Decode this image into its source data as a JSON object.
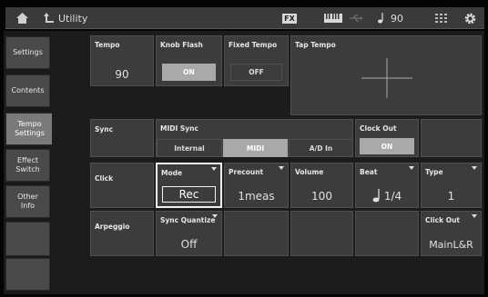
{
  "topbar": {
    "title": "Utility",
    "fx_label": "FX",
    "tempo": "90",
    "icons": [
      "home-icon",
      "back-arrow-icon",
      "keyboard-icon",
      "usb-icon",
      "note-icon",
      "grid-icon",
      "gear-icon"
    ]
  },
  "sidebar": {
    "items": [
      {
        "label": "Settings"
      },
      {
        "label": "Contents"
      },
      {
        "label": "Tempo\nSettings"
      },
      {
        "label": "Effect\nSwitch"
      },
      {
        "label": "Other\nInfo"
      }
    ]
  },
  "tempo": {
    "label": "Tempo",
    "value": "90"
  },
  "knob_flash": {
    "label": "Knob Flash",
    "value": "ON"
  },
  "fixed_tempo": {
    "label": "Fixed Tempo",
    "value": "OFF"
  },
  "tap_tempo": {
    "label": "Tap Tempo"
  },
  "sync": {
    "label": "Sync",
    "midi_sync_label": "MIDI Sync",
    "options": [
      "Internal",
      "MIDI",
      "A/D In"
    ],
    "selected": "MIDI",
    "clock_out_label": "Clock Out",
    "clock_out_value": "ON"
  },
  "click": {
    "label": "Click",
    "mode_label": "Mode",
    "mode_value": "Rec",
    "precount_label": "Precount",
    "precount_value": "1meas",
    "volume_label": "Volume",
    "volume_value": "100",
    "beat_label": "Beat",
    "beat_value": "1/4",
    "type_label": "Type",
    "type_value": "1"
  },
  "arpeggio": {
    "label": "Arpeggio",
    "sync_quantize_label": "Sync Quantize",
    "sync_quantize_value": "Off",
    "click_out_label": "Click Out",
    "click_out_value": "MainL&R"
  },
  "colors": {
    "active_button": "#a9a9a9",
    "cell_bg": "#3c3c3c",
    "topbar_bg": "#3a3a3a"
  }
}
